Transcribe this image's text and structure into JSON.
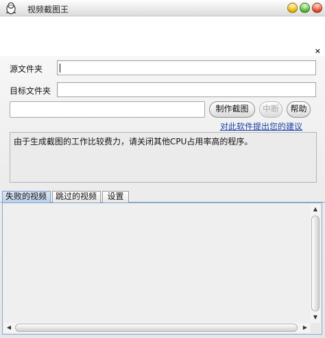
{
  "window": {
    "title": "视频截图王",
    "app_icon": "penguin-icon",
    "controls": [
      "minimize-button",
      "maximize-button",
      "close-button"
    ]
  },
  "banner": {
    "close_label": "×"
  },
  "form": {
    "source_label": "源文件夹",
    "source_value": "",
    "target_label": "目标文件夹",
    "target_value": ""
  },
  "buttons": {
    "make": "制作截图",
    "stop": "中断",
    "help": "帮助"
  },
  "feedback_link": "对此软件提出您的建议",
  "notice": "由于生成截图的工作比较费力，请关闭其他CPU占用率高的程序。",
  "tabs": [
    {
      "label": "失败的视频",
      "active": true
    },
    {
      "label": "跳过的视频",
      "active": false
    },
    {
      "label": "设置",
      "active": false
    }
  ],
  "colors": {
    "link": "#1b3fa8",
    "active_tab": "#b9cfea"
  }
}
